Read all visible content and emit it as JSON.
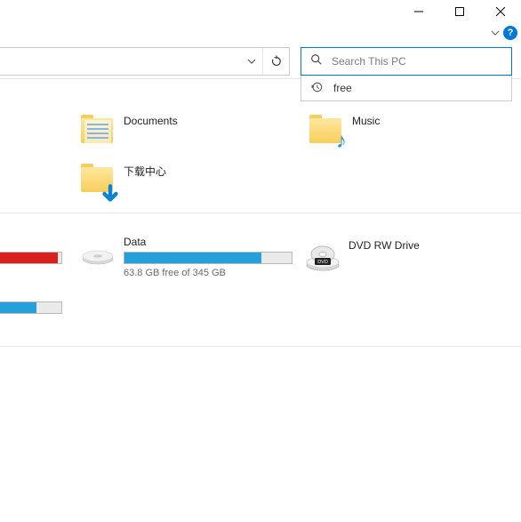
{
  "window": {
    "help_label": "?"
  },
  "search": {
    "placeholder": "Search This PC",
    "value": "",
    "history_item": "free"
  },
  "folders": {
    "documents": "Documents",
    "music": "Music",
    "downloads_cn": "下载中心"
  },
  "drives": {
    "data": {
      "label": "Data",
      "free_text": "63.8 GB free of 345 GB",
      "fill_percent": 82
    },
    "dvd": {
      "label": "DVD RW Drive"
    }
  }
}
